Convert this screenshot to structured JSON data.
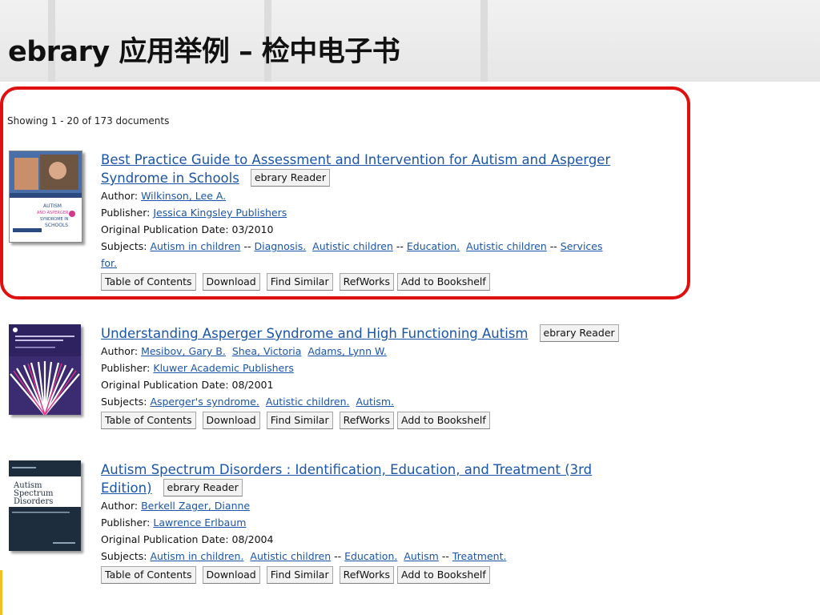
{
  "slide": {
    "title": "ebrary 应用举例 – 检中电子书"
  },
  "results_info": "Showing 1 - 20 of 173 documents",
  "labels": {
    "author": "Author:",
    "publisher": "Publisher:",
    "pubdate": "Original Publication Date:",
    "subjects": "Subjects:"
  },
  "buttons": {
    "reader": "ebrary Reader",
    "toc": "Table of Contents",
    "download": "Download",
    "similar": "Find Similar",
    "refworks": "RefWorks",
    "bookshelf": "Add to Bookshelf"
  },
  "results": [
    {
      "title_l1": "Best Practice Guide to Assessment and Intervention for Autism and Asperger",
      "title_l2": "Syndrome in Schools",
      "authors": [
        "Wilkinson, Lee A."
      ],
      "publisher": "Jessica Kingsley Publishers",
      "date": "03/2010",
      "subjects_l1": [
        "Autism in children",
        "--",
        "Diagnosis.",
        "Autistic children",
        "--",
        "Education.",
        "Autistic children",
        "--",
        "Services"
      ],
      "subjects_l2": "for.",
      "cover_text": [
        "AUTISM",
        "AND ASPERGER",
        "SYNDROME IN",
        "SCHOOLS"
      ]
    },
    {
      "title_l1": "Understanding Asperger Syndrome and High Functioning Autism",
      "authors": [
        "Mesibov, Gary B.",
        "Shea, Victoria",
        "Adams, Lynn W."
      ],
      "publisher": "Kluwer Academic Publishers",
      "date": "08/2001",
      "subjects_l1": [
        "Asperger's syndrome.",
        "Autistic children.",
        "Autism."
      ]
    },
    {
      "title_l1": "Autism Spectrum Disorders : Identification, Education, and Treatment (3rd",
      "title_l2": "Edition)",
      "authors": [
        "Berkell Zager, Dianne"
      ],
      "publisher": "Lawrence Erlbaum",
      "date": "08/2004",
      "subjects_l1": [
        "Autism in children.",
        "Autistic children",
        "--",
        "Education.",
        "Autism",
        "--",
        "Treatment."
      ],
      "cover_text": [
        "Autism",
        "Spectrum",
        "Disorders"
      ]
    }
  ]
}
